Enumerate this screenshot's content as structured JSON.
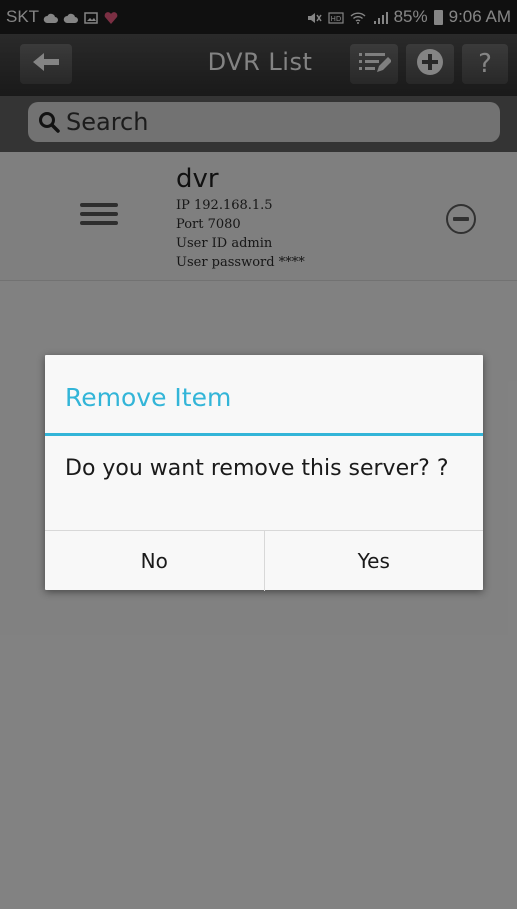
{
  "status_bar": {
    "carrier": "SKT",
    "battery": "85%",
    "time": "9:06 AM",
    "icons": [
      "cloud-icon",
      "cloud-icon",
      "image-icon",
      "heart-icon",
      "mute-icon",
      "hd-voice-icon",
      "wifi-icon",
      "signal-icon",
      "battery-icon"
    ]
  },
  "header": {
    "title": "DVR List",
    "help_label": "?"
  },
  "search": {
    "placeholder": "Search"
  },
  "list": [
    {
      "name": "dvr",
      "ip": "IP 192.168.1.5",
      "port": "Port 7080",
      "user_id": "User ID admin",
      "user_password": "User password ****"
    }
  ],
  "dialog": {
    "title": "Remove Item",
    "message": "Do you want remove this server? ?",
    "no_label": "No",
    "yes_label": "Yes"
  },
  "colors": {
    "accent": "#33b5d8",
    "titlebar": "#3a3a3a",
    "statusbar": "#1e1e1e"
  }
}
